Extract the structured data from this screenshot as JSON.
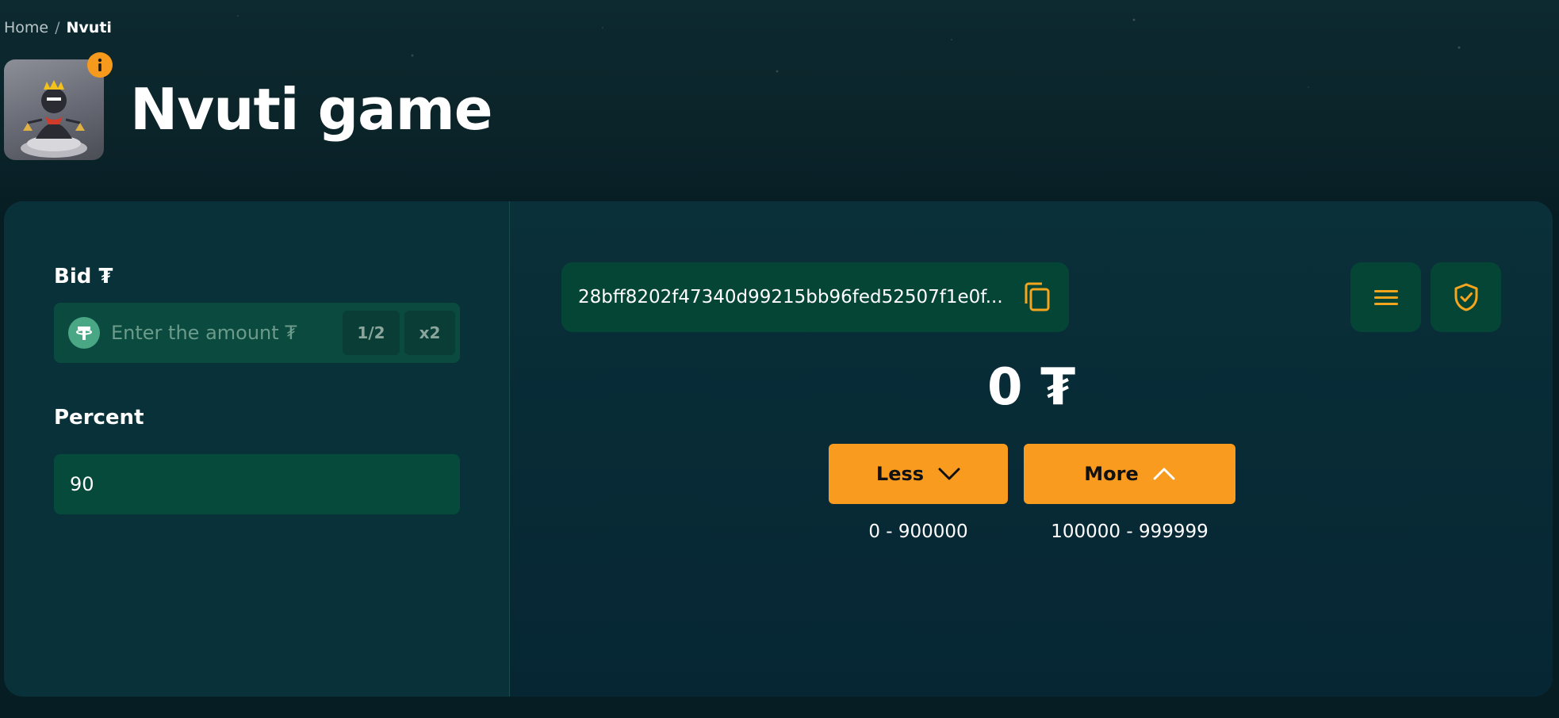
{
  "breadcrumb": {
    "home": "Home",
    "separator": "/",
    "current": "Nvuti"
  },
  "game": {
    "title": "Nvuti game",
    "thumbnail": "nvuti-character-thumbnail",
    "info_icon": "info-icon"
  },
  "bid": {
    "label": "Bid ₮",
    "placeholder": "Enter the amount ₮",
    "value": "",
    "currency_icon": "tether-icon",
    "half_label": "1/2",
    "double_label": "x2"
  },
  "percent": {
    "label": "Percent",
    "value": "90"
  },
  "hash": {
    "text": "28bff8202f47340d99215bb96fed52507f1e0f...",
    "copy_icon": "copy-icon"
  },
  "toolbar": {
    "list_icon": "menu-icon",
    "fairness_icon": "shield-check-icon"
  },
  "result": {
    "amount": "0 ₮"
  },
  "actions": {
    "less_label": "Less",
    "less_range": "0 - 900000",
    "more_label": "More",
    "more_range": "100000 - 999999"
  },
  "colors": {
    "accent": "#f89b1e",
    "background": "#071d24",
    "panel": "#093139",
    "input": "#0b4a3f"
  }
}
